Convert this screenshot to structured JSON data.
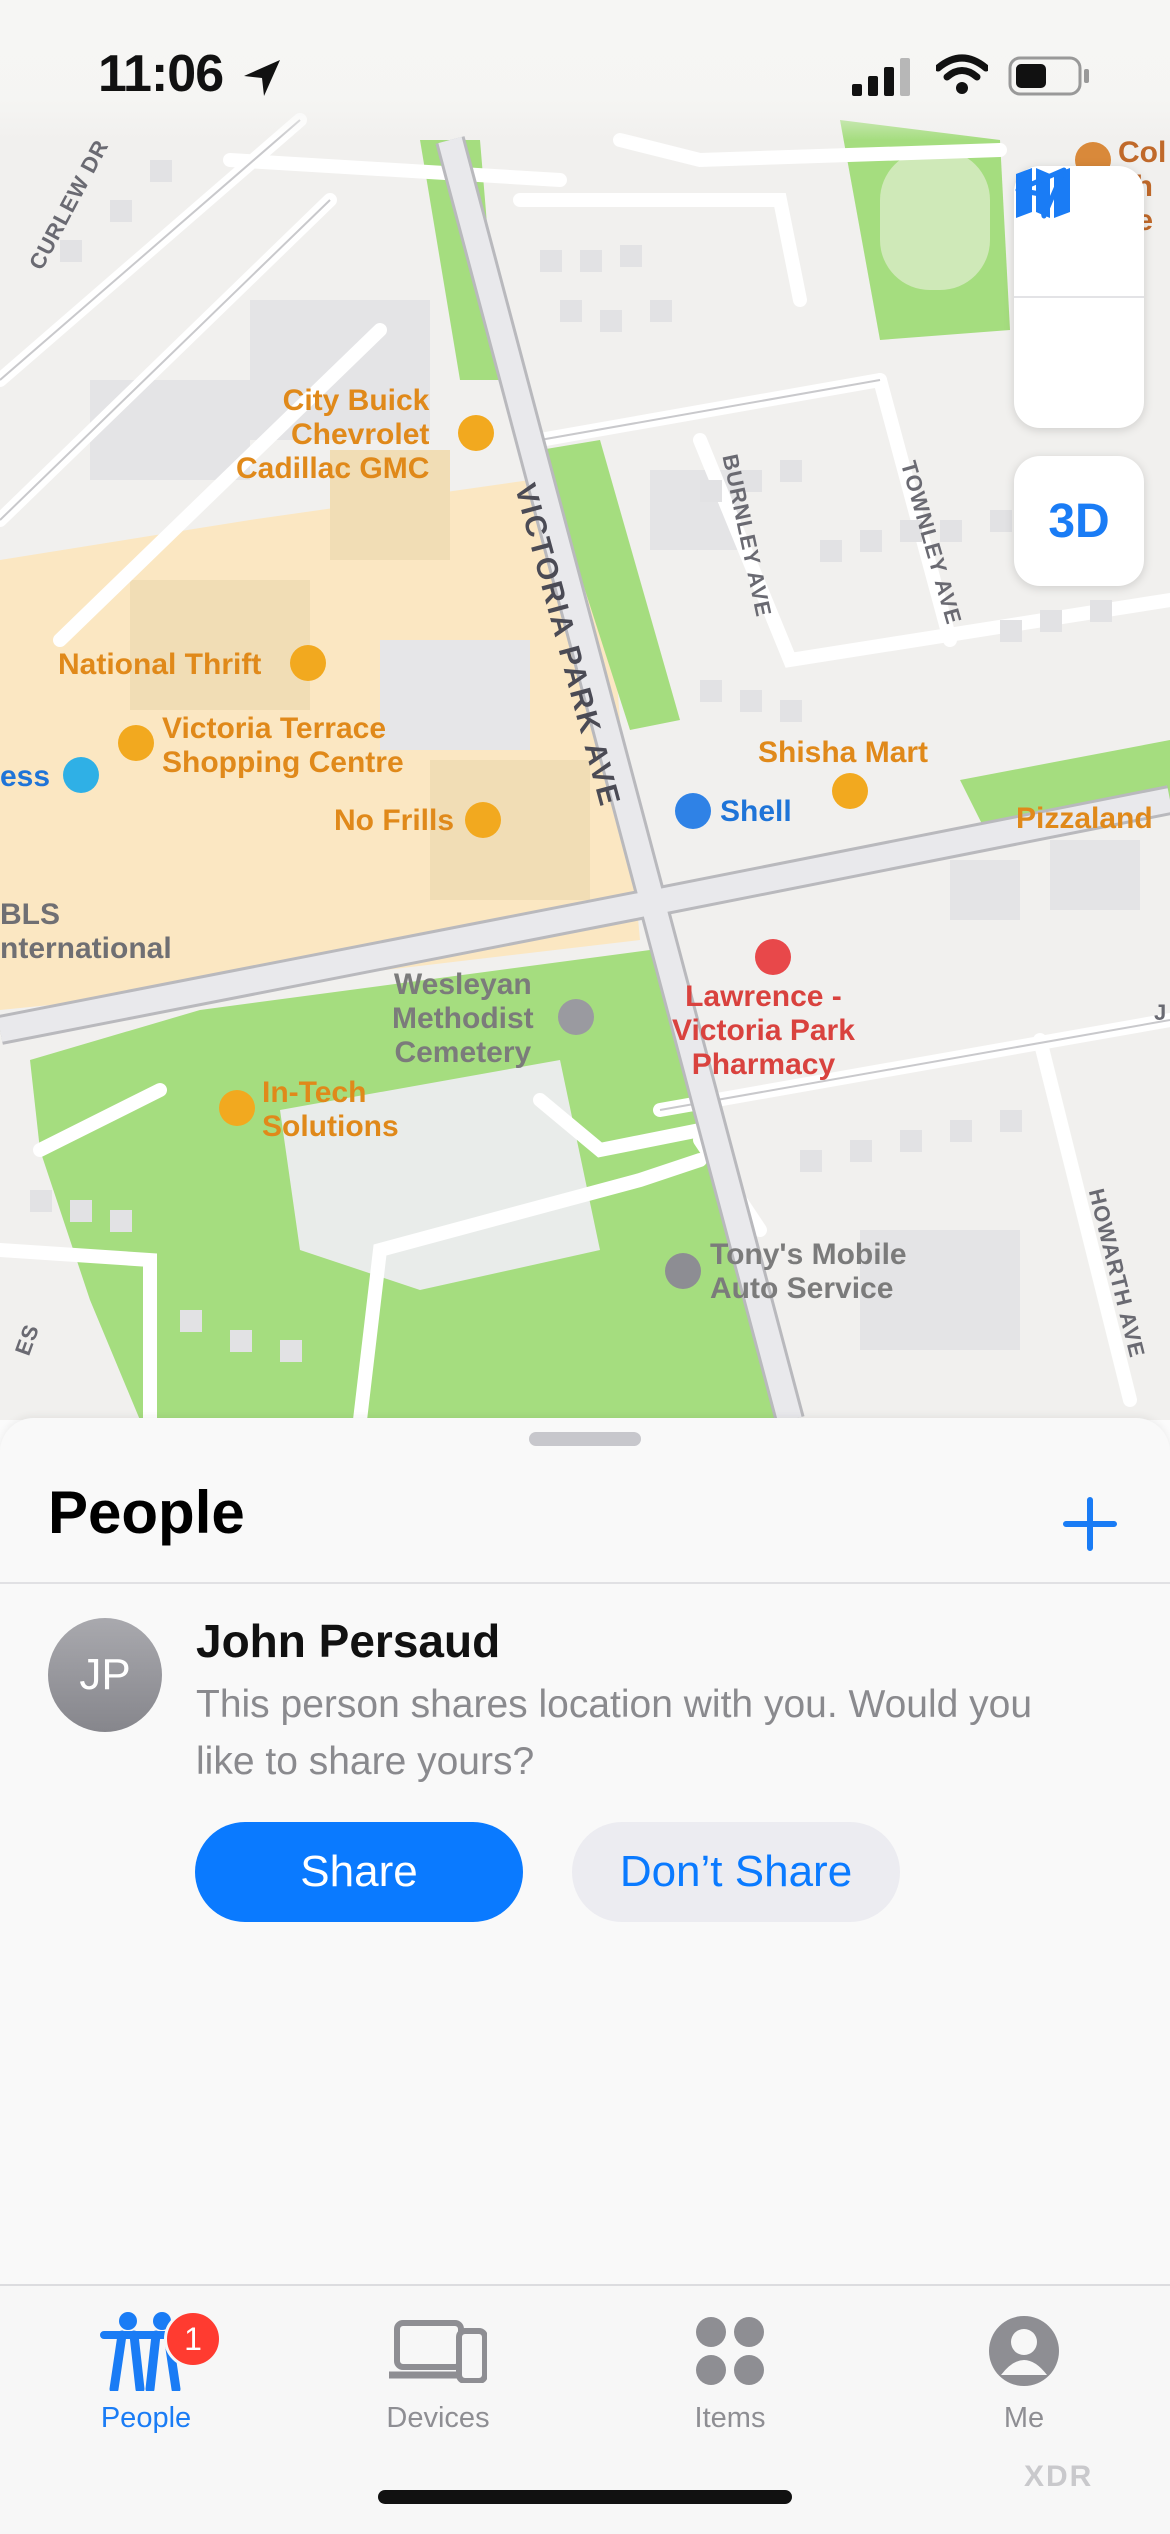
{
  "status_bar": {
    "time": "11:06"
  },
  "map": {
    "streets": {
      "curlew": "CURLEW DR",
      "victoria_park": "VICTORIA PARK AVE",
      "burnley": "BURNLEY AVE",
      "townley": "TOWNLEY AVE",
      "howarth": "HOWARTH AVE",
      "partial_s": "ES",
      "partial_j": "J"
    },
    "places": {
      "city_buick": "City Buick\nChevrolet\nCadillac GMC",
      "national_thrift": "National Thrift",
      "victoria_terrace": "Victoria Terrace\nShopping Centre",
      "ess": "ess",
      "no_frills": "No Frills",
      "bls": "BLS\nnternational",
      "shell": "Shell",
      "shisha_mart": "Shisha Mart",
      "pizzaland": "Pizzaland",
      "wesleyan": "Wesleyan\nMethodist\nCemetery",
      "lawrence_pharmacy": "Lawrence -\nVictoria Park\nPharmacy",
      "in_tech": "In-Tech\nSolutions",
      "tonys": "Tony's Mobile\nAuto Service",
      "col_partial": "Col\nch\nhe"
    },
    "controls": {
      "three_d": "3D"
    }
  },
  "sheet": {
    "title": "People",
    "person": {
      "initials": "JP",
      "name": "John Persaud",
      "message": "This person shares location with you. Would you like to share yours?",
      "share_label": "Share",
      "dont_share_label": "Don’t Share"
    }
  },
  "tabs": [
    {
      "label": "People",
      "icon": "people-icon",
      "active": true,
      "badge": "1"
    },
    {
      "label": "Devices",
      "icon": "devices-icon",
      "active": false
    },
    {
      "label": "Items",
      "icon": "items-icon",
      "active": false
    },
    {
      "label": "Me",
      "icon": "me-icon",
      "active": false
    }
  ],
  "watermark": "XDR",
  "colors": {
    "accent": "#0a7aff",
    "badge": "#ff3b30",
    "park": "#a5dd7f",
    "mall": "#fbe7c2"
  }
}
